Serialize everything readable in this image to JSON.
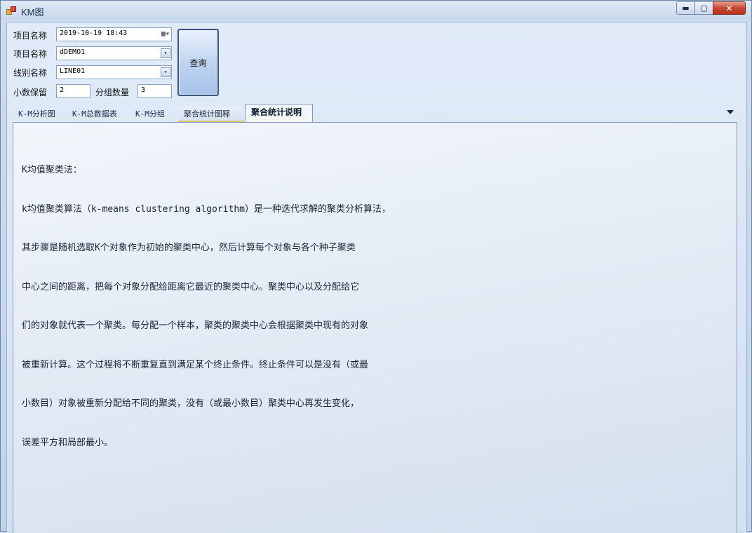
{
  "window": {
    "title": "KM图",
    "min_glyph": "▬",
    "max_glyph": "▢",
    "close_glyph": "✕"
  },
  "form": {
    "project_date_label": "项目名称",
    "project_date_value": "2019-10-19 18:43",
    "project_name_label": "项目名称",
    "project_name_value": "dDEMO1",
    "line_label": "线别名称",
    "line_value": "LINE01",
    "decimal_label": "小数保留",
    "decimal_value": "2",
    "group_label": "分组数量",
    "group_value": "3",
    "query_button": "查询",
    "calendar_glyph": "▦▾",
    "dropdown_glyph": "▾"
  },
  "tabs": [
    {
      "label": "K-M分析图"
    },
    {
      "label": "K-M总数据表"
    },
    {
      "label": "K-M分组"
    },
    {
      "label": "聚合统计图释"
    },
    {
      "label": "聚合统计说明"
    }
  ],
  "tab_menu_glyph": "",
  "description": {
    "lines": [
      "K均值聚类法：",
      "k均值聚类算法（k-means clustering algorithm）是一种迭代求解的聚类分析算法，",
      "其步骤是随机选取K个对象作为初始的聚类中心，然后计算每个对象与各个种子聚类",
      "中心之间的距离，把每个对象分配给距离它最近的聚类中心。聚类中心以及分配给它",
      "们的对象就代表一个聚类。每分配一个样本，聚类的聚类中心会根据聚类中现有的对象",
      "被重新计算。这个过程将不断重复直到满足某个终止条件。终止条件可以是没有（或最",
      "小数目）对象被重新分配给不同的聚类，没有（或最小数目）聚类中心再发生变化，",
      "误差平方和局部最小。"
    ]
  }
}
